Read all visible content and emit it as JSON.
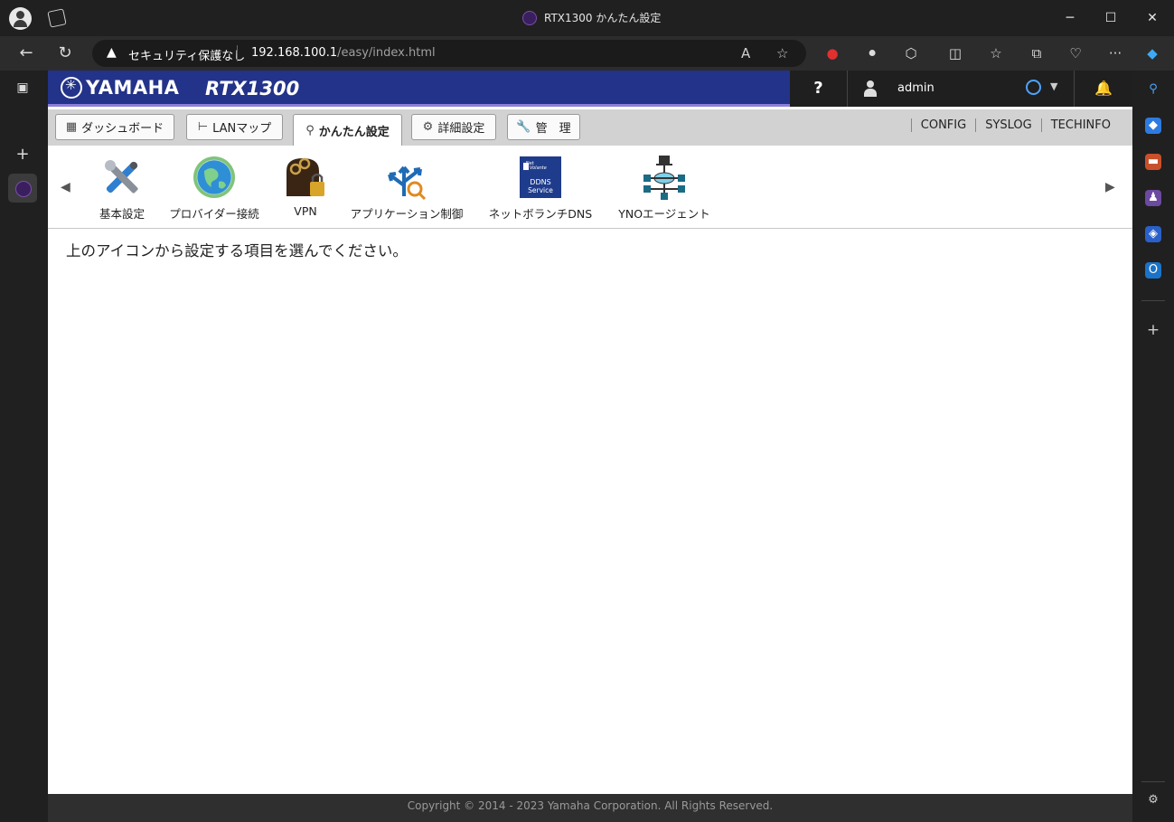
{
  "browser": {
    "tab_title": "RTX1300 かんたん設定",
    "security_label": "セキュリティ保護なし",
    "url_host": "192.168.100.1",
    "url_path": "/easy/index.html"
  },
  "header": {
    "brand": "YAMAHA",
    "model": "RTX1300",
    "help": "?",
    "user": "admin"
  },
  "menu": {
    "tabs": [
      {
        "label": "ダッシュボード"
      },
      {
        "label": "LANマップ"
      },
      {
        "label": "かんたん設定"
      },
      {
        "label": "詳細設定"
      },
      {
        "label": "管　理"
      }
    ],
    "active_tab": "かんたん設定",
    "links": [
      "CONFIG",
      "SYSLOG",
      "TECHINFO"
    ]
  },
  "categories": [
    {
      "label": "基本設定",
      "icon": "tools-icon"
    },
    {
      "label": "プロバイダー接続",
      "icon": "globe-icon"
    },
    {
      "label": "VPN",
      "icon": "vpn-lock-icon"
    },
    {
      "label": "アプリケーション制御",
      "icon": "app-control-icon"
    },
    {
      "label": "ネットボランチDNS",
      "icon": "ddns-icon",
      "badge": [
        "Net",
        "Volante",
        "DDNS",
        "Service"
      ]
    },
    {
      "label": "YNOエージェント",
      "icon": "network-agent-icon"
    }
  ],
  "message": "上のアイコンから設定する項目を選んでください。",
  "footer": "Copyright © 2014 - 2023 Yamaha Corporation. All Rights Reserved."
}
